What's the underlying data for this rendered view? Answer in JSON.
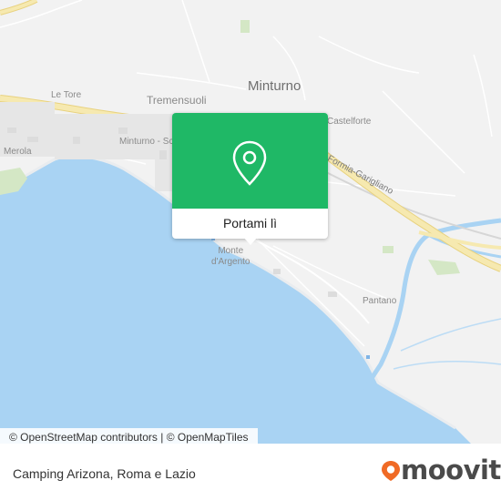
{
  "map": {
    "labels": {
      "minturno": "Minturno",
      "tremensuoli": "Tremensuoli",
      "le_tore": "Le Tore",
      "merola": "Merola",
      "minturno_scauri": "Minturno - Sca",
      "castelforte": "Castelforte",
      "road_garigliano": "Formia-Garigliano",
      "monte_dargento_1": "Monte",
      "monte_dargento_2": "d'Argento",
      "pantano": "Pantano"
    },
    "colors": {
      "land": "#f2f2f2",
      "sea": "#a9d3f3",
      "highway": "#f3e5a6",
      "highway_edge": "#e8d27f",
      "road": "#ffffff",
      "park": "#d4e7c5",
      "popup_green": "#1fb866",
      "moovit_orange": "#f06a25"
    }
  },
  "popup": {
    "button_label": "Portami lì",
    "pin_icon": "location-pin-icon"
  },
  "attribution": {
    "osm": "© OpenStreetMap contributors",
    "separator": "|",
    "omt": "© OpenMapTiles"
  },
  "footer": {
    "place": "Camping Arizona, Roma e Lazio",
    "logo_text": "moovit",
    "logo_icon": "moovit-pin-icon"
  }
}
